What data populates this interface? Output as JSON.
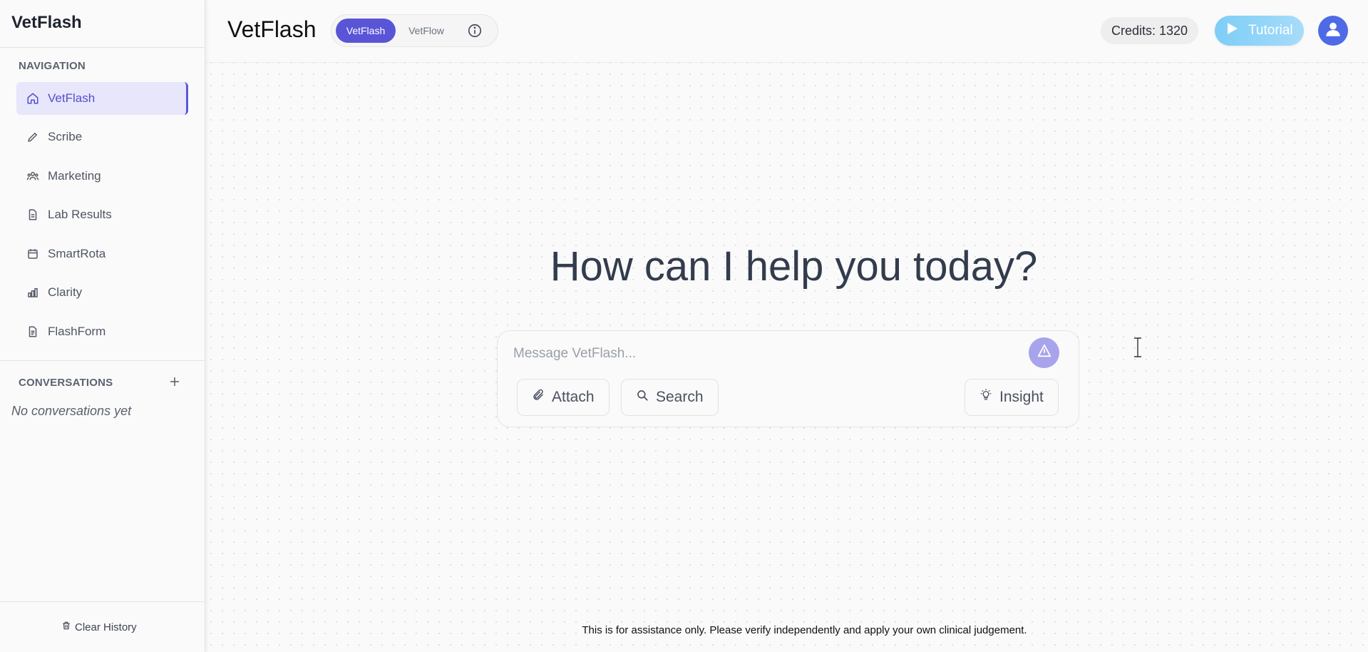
{
  "sidebar": {
    "brand": "VetFlash",
    "navigation_label": "NAVIGATION",
    "items": [
      {
        "label": "VetFlash",
        "icon": "home-icon",
        "active": true
      },
      {
        "label": "Scribe",
        "icon": "pencil-icon",
        "active": false
      },
      {
        "label": "Marketing",
        "icon": "users-icon",
        "active": false
      },
      {
        "label": "Lab Results",
        "icon": "document-icon",
        "active": false
      },
      {
        "label": "SmartRota",
        "icon": "calendar-icon",
        "active": false
      },
      {
        "label": "Clarity",
        "icon": "bar-chart-icon",
        "active": false
      },
      {
        "label": "FlashForm",
        "icon": "form-icon",
        "active": false
      }
    ],
    "conversations_label": "CONVERSATIONS",
    "empty_conversations": "No conversations yet",
    "clear_history": "Clear History"
  },
  "header": {
    "title": "VetFlash",
    "mode_options": [
      "VetFlash",
      "VetFlow"
    ],
    "selected_mode": "VetFlash",
    "credits": "Credits: 1320",
    "tutorial_label": "Tutorial"
  },
  "main": {
    "greeting": "How can I help you today?",
    "input_placeholder": "Message VetFlash...",
    "input_value": "",
    "attach_label": "Attach",
    "search_label": "Search",
    "insight_label": "Insight",
    "disclaimer": "This is for assistance only. Please verify independently and apply your own clinical judgement."
  },
  "colors": {
    "accent": "#5a55d6",
    "active_nav_bg": "#e7e6fb",
    "send_button": "#a7a4ec",
    "tutorial": "#7dcdf7",
    "avatar": "#4f6ae6"
  }
}
